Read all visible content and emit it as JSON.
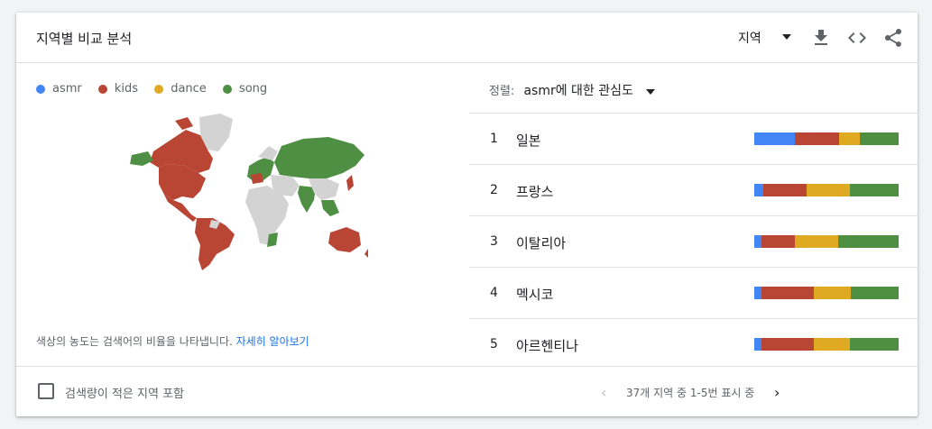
{
  "header": {
    "title": "지역별 비교 분석",
    "region_label": "지역",
    "icons": [
      "download-icon",
      "embed-icon",
      "share-icon"
    ]
  },
  "legend": [
    {
      "label": "asmr",
      "color": "#4285f4"
    },
    {
      "label": "kids",
      "color": "#b94634"
    },
    {
      "label": "dance",
      "color": "#e0a922"
    },
    {
      "label": "song",
      "color": "#4e8f43"
    }
  ],
  "note": {
    "text": "색상의 농도는 검색어의 비율을 나타냅니다.",
    "link": "자세히 알아보기"
  },
  "sort": {
    "label": "정렬:",
    "value": "asmr에 대한 관심도"
  },
  "rows": [
    {
      "rank": "1",
      "name": "일본",
      "shares": [
        0.28,
        0.31,
        0.14,
        0.27
      ]
    },
    {
      "rank": "2",
      "name": "프랑스",
      "shares": [
        0.06,
        0.3,
        0.3,
        0.34
      ]
    },
    {
      "rank": "3",
      "name": "이탈리아",
      "shares": [
        0.05,
        0.23,
        0.3,
        0.42
      ]
    },
    {
      "rank": "4",
      "name": "멕시코",
      "shares": [
        0.05,
        0.36,
        0.26,
        0.33
      ]
    },
    {
      "rank": "5",
      "name": "아르헨티나",
      "shares": [
        0.05,
        0.36,
        0.25,
        0.34
      ]
    }
  ],
  "footer": {
    "checkbox_label": "검색량이 적은 지역 포함",
    "pagination": "37개 지역 중 1-5번 표시 중",
    "prev": "‹",
    "next": "›"
  }
}
